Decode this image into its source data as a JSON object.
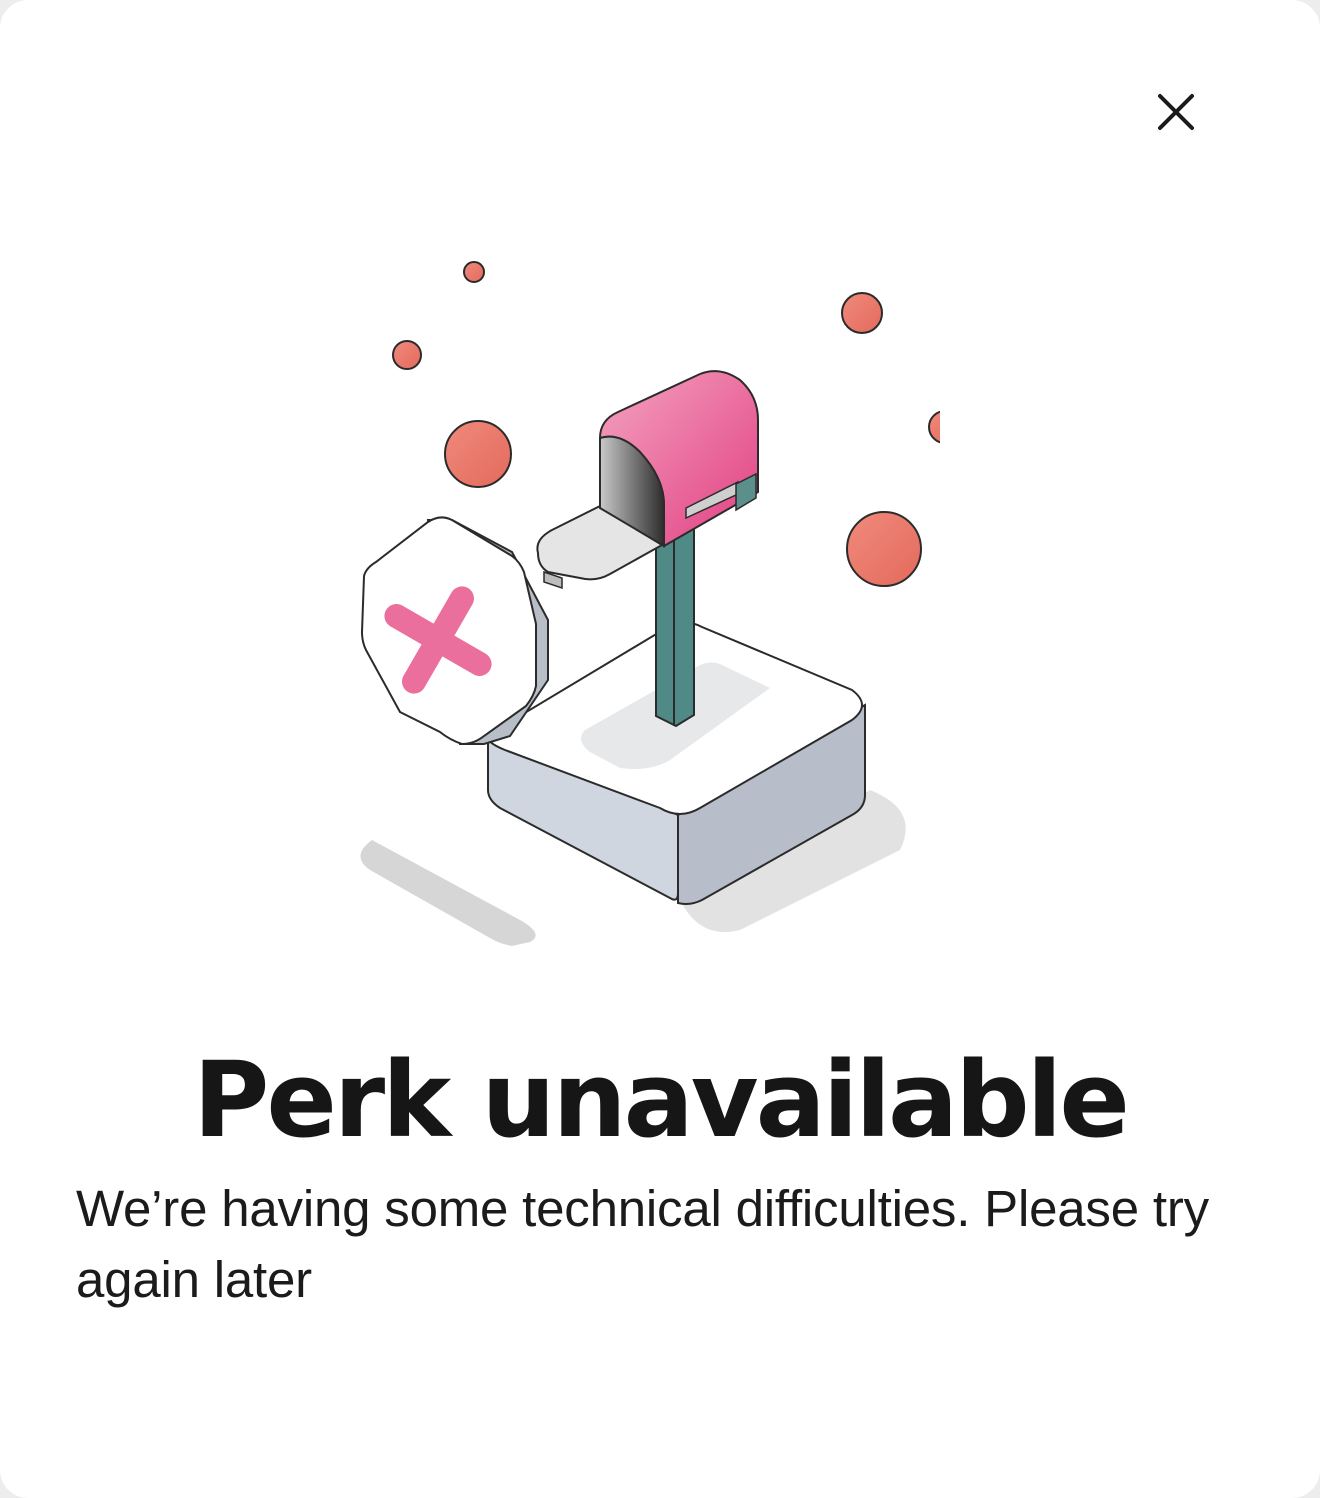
{
  "dialog": {
    "title": "Perk unavailable",
    "message": "We’re having some technical difficulties. Please try again later",
    "close_icon": "close-icon"
  },
  "illustration": {
    "subject": "mailbox-with-error-sign",
    "accent_colors": {
      "mailbox": "#e8508c",
      "error_cross": "#ea6f9c",
      "bubbles": "#e98070",
      "post": "#4f8a87"
    }
  },
  "colors": {
    "background": "#ffffff",
    "text": "#161616"
  }
}
